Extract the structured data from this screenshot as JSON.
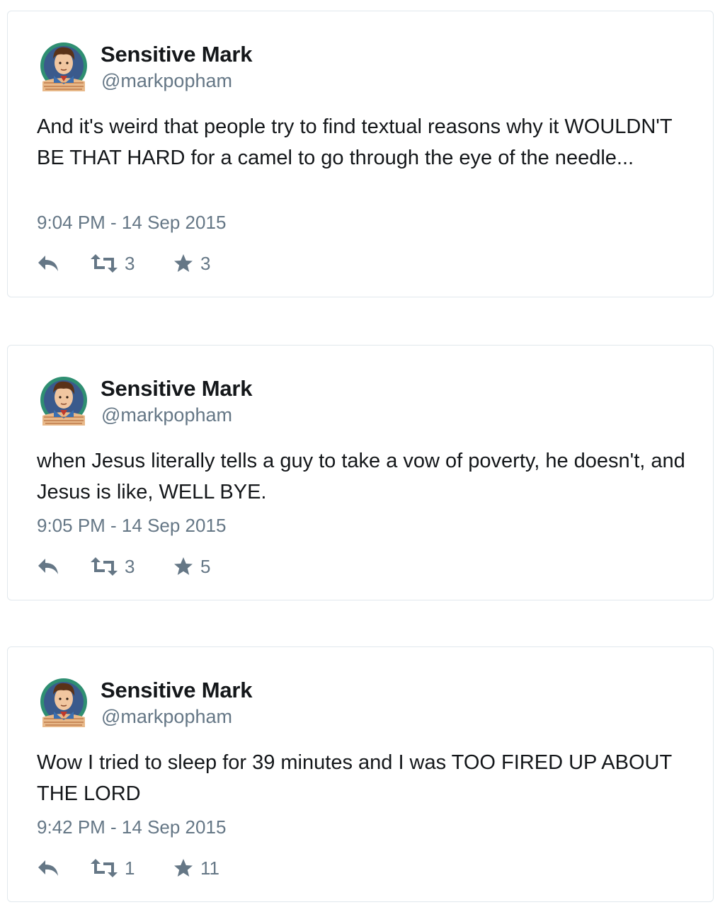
{
  "author": {
    "name": "Sensitive Mark",
    "handle": "@markpopham"
  },
  "colors": {
    "text": "#14171a",
    "secondary": "#657786",
    "border": "#e1e8ed"
  },
  "icons": {
    "reply": "reply-icon",
    "retweet": "retweet-icon",
    "favorite": "star-icon"
  },
  "tweets": [
    {
      "text": "And it's weird that people try to find textual reasons why it WOULDN'T BE THAT HARD for a camel to go through the eye of the needle...",
      "timestamp": "9:04 PM - 14 Sep 2015",
      "retweets": "3",
      "favorites": "3"
    },
    {
      "text": "when Jesus literally tells a guy to take a vow of poverty, he doesn't, and Jesus is like, WELL BYE.",
      "timestamp": "9:05 PM - 14 Sep 2015",
      "retweets": "3",
      "favorites": "5"
    },
    {
      "text": "Wow I tried to sleep for 39 minutes and I was TOO FIRED UP ABOUT THE LORD",
      "timestamp": "9:42 PM - 14 Sep 2015",
      "retweets": "1",
      "favorites": "11"
    }
  ]
}
